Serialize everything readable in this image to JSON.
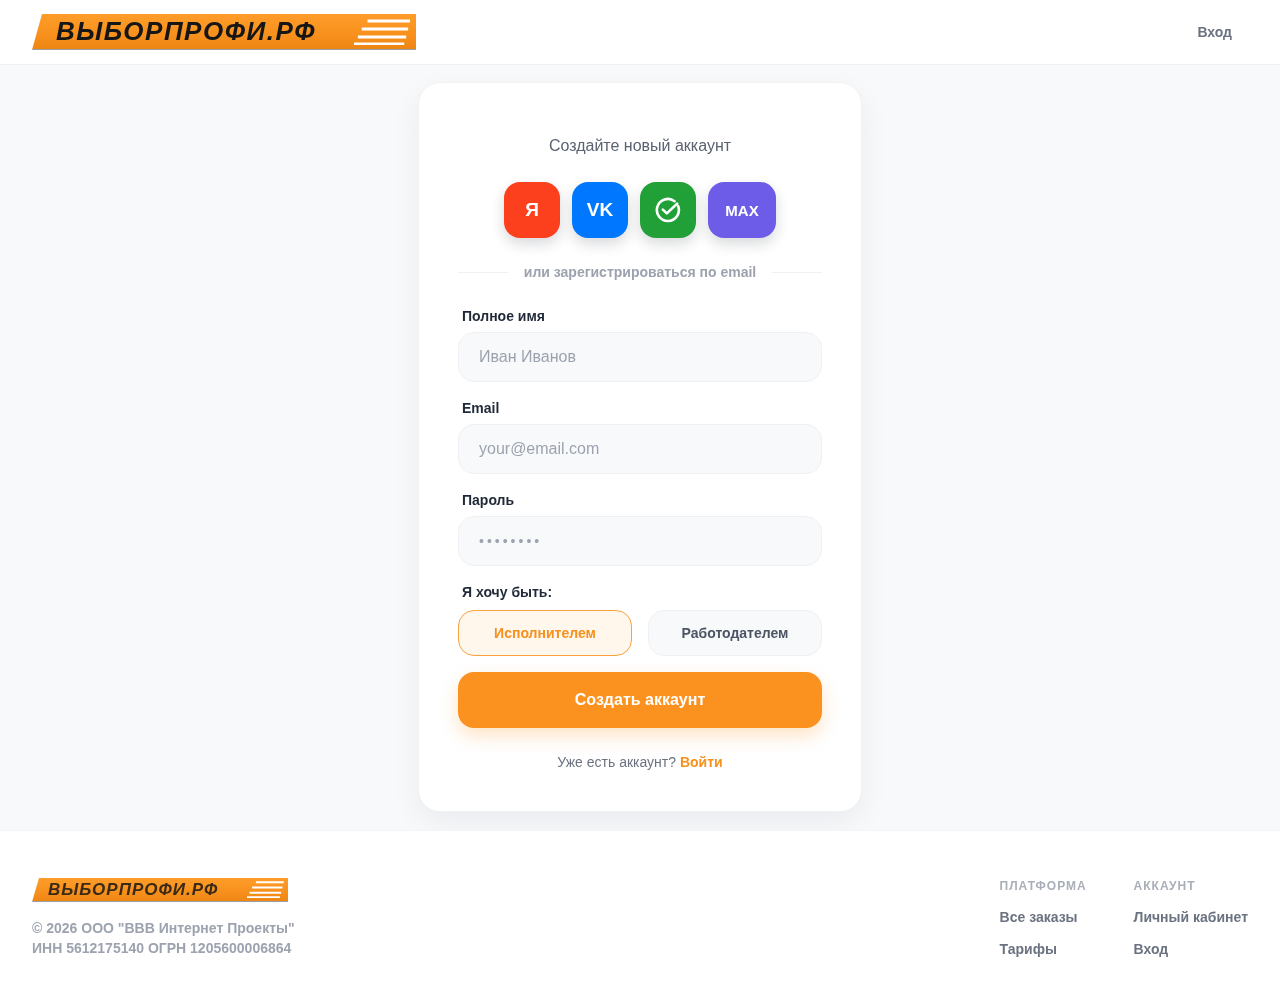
{
  "header": {
    "logo": "ВЫБОРПРОФИ.РФ",
    "nav": [
      {
        "label": "Вход"
      }
    ]
  },
  "card": {
    "title": "Создайте новый аккаунт",
    "social_buttons": [
      {
        "kind": "text",
        "label": "Я",
        "color": "#fc3f1d"
      },
      {
        "kind": "text",
        "label": "VK",
        "color": "#0077ff"
      },
      {
        "kind": "icon",
        "color": "#21a038"
      },
      {
        "kind": "text",
        "label": "MAX",
        "color": "#6c5ce7"
      }
    ],
    "divider": "или зарегистрироваться по email",
    "fields": [
      {
        "kind": "text",
        "label": "Полное имя",
        "placeholder": "Иван Иванов"
      },
      {
        "kind": "email",
        "label": "Email",
        "placeholder": "your@email.com"
      },
      {
        "kind": "password",
        "label": "Пароль",
        "placeholder": "••••••••"
      }
    ],
    "role_label": "Я хочу быть:",
    "roles": [
      {
        "label": "Исполнителем",
        "selected": true
      },
      {
        "label": "Работодателем",
        "selected": false
      }
    ],
    "submit": "Создать аккаунт",
    "login_prompt": "Уже есть аккаунт?",
    "login_link": "Войти"
  },
  "footer": {
    "logo": "ВЫБОРПРОФИ.РФ",
    "copyright": "© 2026 ООО \"ВВВ Интернет Проекты\"",
    "legal": "ИНН 5612175140 ОГРН 1205600006864",
    "columns": [
      {
        "heading": "ПЛАТФОРМА",
        "links": [
          "Все заказы",
          "Тарифы"
        ]
      },
      {
        "heading": "АККАУНТ",
        "links": [
          "Личный кабинет",
          "Вход"
        ]
      }
    ]
  }
}
